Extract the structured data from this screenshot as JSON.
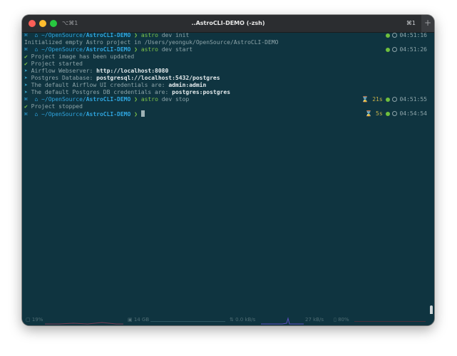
{
  "window": {
    "tab_left": "⌥⌘1",
    "title": "..AstroCLI-DEMO (-zsh)",
    "tab_right": "⌘1",
    "new_tab": "+"
  },
  "colors": {
    "background": "#0f3440",
    "prompt_path": "#2fa6e0",
    "success": "#7fc348"
  },
  "terminal": {
    "prompt_prefix": "⌘  ⌂ ~/OpenSource/",
    "prompt_dir": "AstroCLI-DEMO",
    "prompt_arrow": "❯",
    "lines": [
      {
        "cmd_name": "astro",
        "cmd_args": " dev init",
        "time": "04:51:16"
      },
      {
        "text": "Initialized empty Astro project in /Users/yeonguk/OpenSource/AstroCLI-DEMO"
      },
      {
        "cmd_name": "astro",
        "cmd_args": " dev start",
        "time": "04:51:26"
      },
      {
        "mark": "✔",
        "text": " Project image has been updated"
      },
      {
        "mark": "✔",
        "text": " Project started"
      },
      {
        "mark": "➤",
        "text": " Airflow Webserver: ",
        "value": "http://localhost:8080"
      },
      {
        "mark": "➤",
        "text": " Postgres Database: ",
        "value": "postgresql://localhost:5432/postgres"
      },
      {
        "mark": "➤",
        "text": " The default Airflow UI credentials are: ",
        "value": "admin:admin"
      },
      {
        "mark": "➤",
        "text": " The default Postgres DB credentials are: ",
        "value": "postgres:postgres"
      },
      {
        "cmd_name": "astro",
        "cmd_args": " dev stop",
        "duration": "21s",
        "time": "04:51:55"
      },
      {
        "mark": "✔",
        "text": " Project stopped"
      },
      {
        "duration": "5s",
        "time": "04:54:54"
      }
    ],
    "hourglass": "⌛"
  },
  "statusbar": {
    "cpu": "19%",
    "memory": "14 GB",
    "net_up": "0.0 kB/s",
    "net_down": "27 kB/s",
    "battery": "80%"
  }
}
